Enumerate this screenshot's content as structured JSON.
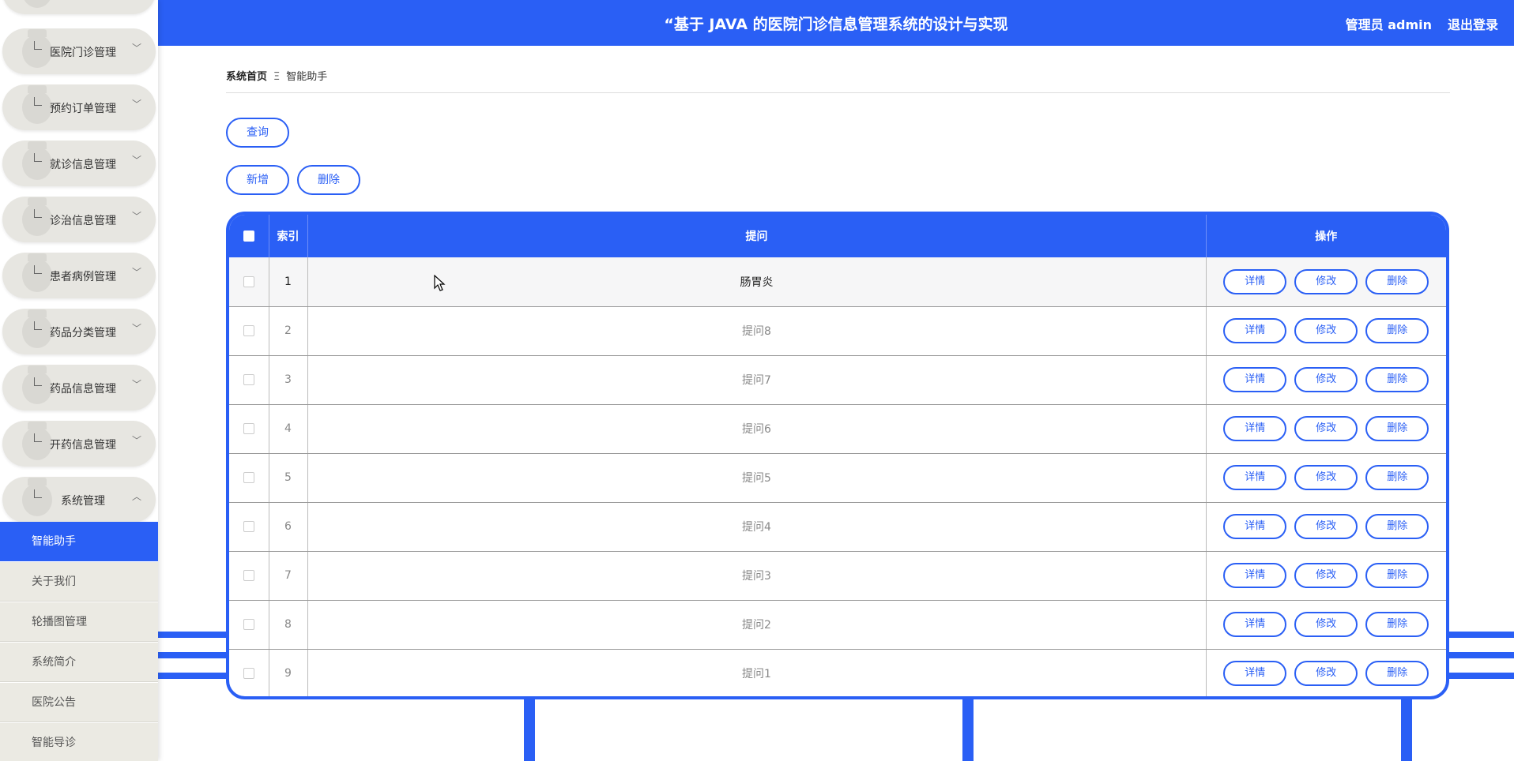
{
  "header": {
    "title": "“基于 JAVA 的医院门诊信息管理系统的设计与实现",
    "user": "管理员 admin",
    "logout": "退出登录"
  },
  "sidebar": {
    "menus": [
      {
        "label": "医院门诊管理"
      },
      {
        "label": "预约订单管理"
      },
      {
        "label": "就诊信息管理"
      },
      {
        "label": "诊治信息管理"
      },
      {
        "label": "患者病例管理"
      },
      {
        "label": "药品分类管理"
      },
      {
        "label": "药品信息管理"
      },
      {
        "label": "开药信息管理"
      },
      {
        "label": "系统管理"
      }
    ],
    "subs": [
      {
        "label": "智能助手"
      },
      {
        "label": "关于我们"
      },
      {
        "label": "轮播图管理"
      },
      {
        "label": "系统简介"
      },
      {
        "label": "医院公告"
      },
      {
        "label": "智能导诊"
      }
    ]
  },
  "breadcrumb": {
    "home": "系统首页",
    "sep": "Ξ",
    "current": "智能助手"
  },
  "buttons": {
    "query": "查询",
    "add": "新增",
    "delete": "删除"
  },
  "table": {
    "headers": {
      "index": "索引",
      "question": "提问",
      "ops": "操作"
    },
    "ops": {
      "detail": "详情",
      "edit": "修改",
      "delete": "删除"
    },
    "rows": [
      {
        "index": "1",
        "question": "肠胃炎"
      },
      {
        "index": "2",
        "question": "提问8"
      },
      {
        "index": "3",
        "question": "提问7"
      },
      {
        "index": "4",
        "question": "提问6"
      },
      {
        "index": "5",
        "question": "提问5"
      },
      {
        "index": "6",
        "question": "提问4"
      },
      {
        "index": "7",
        "question": "提问3"
      },
      {
        "index": "8",
        "question": "提问2"
      },
      {
        "index": "9",
        "question": "提问1"
      }
    ]
  },
  "colors": {
    "accent": "#2a5ff5"
  }
}
